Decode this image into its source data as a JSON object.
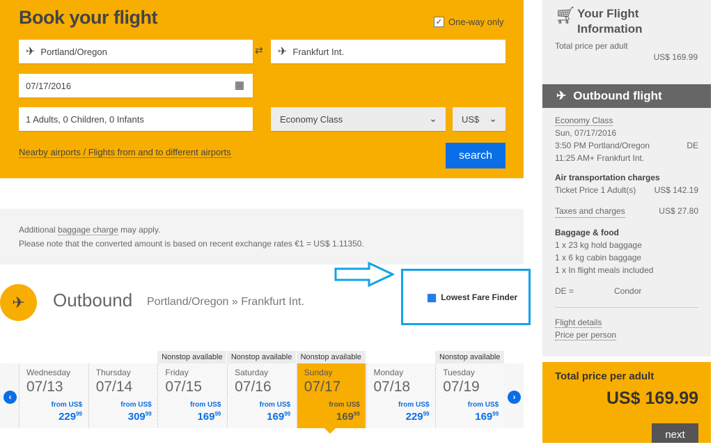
{
  "booking": {
    "title": "Book your flight",
    "one_way_label": "One-way only",
    "one_way_checked": true,
    "origin": "Portland/Oregon",
    "destination": "Frankfurt Int.",
    "date": "07/17/2016",
    "passengers": "1 Adults, 0 Children, 0 Infants",
    "cabin_class": "Economy Class",
    "currency": "US$",
    "nearby_link": "Nearby airports / Flights from and to different airports",
    "search_label": "search"
  },
  "notice": {
    "line1_prefix": "Additional ",
    "line1_link": "baggage charge",
    "line1_suffix": " may apply.",
    "line2": "Please note that the converted amount is based on recent exchange rates €1 = US$ 1.11350."
  },
  "outbound": {
    "title": "Outbound",
    "route": "Portland/Oregon » Frankfurt Int.",
    "lowest_fare_label": "Lowest Fare Finder"
  },
  "days": [
    {
      "day": "Wednesday",
      "date": "07/13",
      "from": "from US$",
      "price": "229",
      "cents": "99",
      "nonstop": ""
    },
    {
      "day": "Thursday",
      "date": "07/14",
      "from": "from US$",
      "price": "309",
      "cents": "99",
      "nonstop": ""
    },
    {
      "day": "Friday",
      "date": "07/15",
      "from": "from US$",
      "price": "169",
      "cents": "99",
      "nonstop": "Nonstop available"
    },
    {
      "day": "Saturday",
      "date": "07/16",
      "from": "from US$",
      "price": "169",
      "cents": "99",
      "nonstop": "Nonstop available"
    },
    {
      "day": "Sunday",
      "date": "07/17",
      "from": "from US$",
      "price": "169",
      "cents": "99",
      "nonstop": "Nonstop available",
      "selected": true
    },
    {
      "day": "Monday",
      "date": "07/18",
      "from": "from US$",
      "price": "229",
      "cents": "99",
      "nonstop": ""
    },
    {
      "day": "Tuesday",
      "date": "07/19",
      "from": "from US$",
      "price": "169",
      "cents": "99",
      "nonstop": "Nonstop available"
    }
  ],
  "sidebar": {
    "title": "Your Flight Information",
    "total_label": "Total price per adult",
    "total_value": "US$ 169.99",
    "outbound_header": "Outbound flight",
    "cabin": "Economy Class",
    "date": "Sun, 07/17/2016",
    "dep": "3:50 PM Portland/Oregon",
    "dep_code": "DE",
    "arr": "11:25 AM+ Frankfurt Int.",
    "air_heading": "Air transportation charges",
    "ticket_label": "Ticket Price 1 Adult(s)",
    "ticket_value": "US$ 142.19",
    "taxes_label": "Taxes and charges",
    "taxes_value": "US$ 27.80",
    "bag_heading": "Baggage & food",
    "bag1": "1 x 23 kg hold baggage",
    "bag2": "1 x 6 kg cabin baggage",
    "bag3": "1 x In flight meals included",
    "carrier_code": "DE =",
    "carrier": "Condor",
    "flight_details": "Flight details",
    "price_per_person": "Price per person",
    "total_box_label": "Total price per adult",
    "total_box_value": "US$ 169.99",
    "next_label": "next"
  },
  "colors": {
    "brand": "#f8ae00",
    "accent": "#0a6fe6",
    "highlight": "#13a3e6"
  }
}
